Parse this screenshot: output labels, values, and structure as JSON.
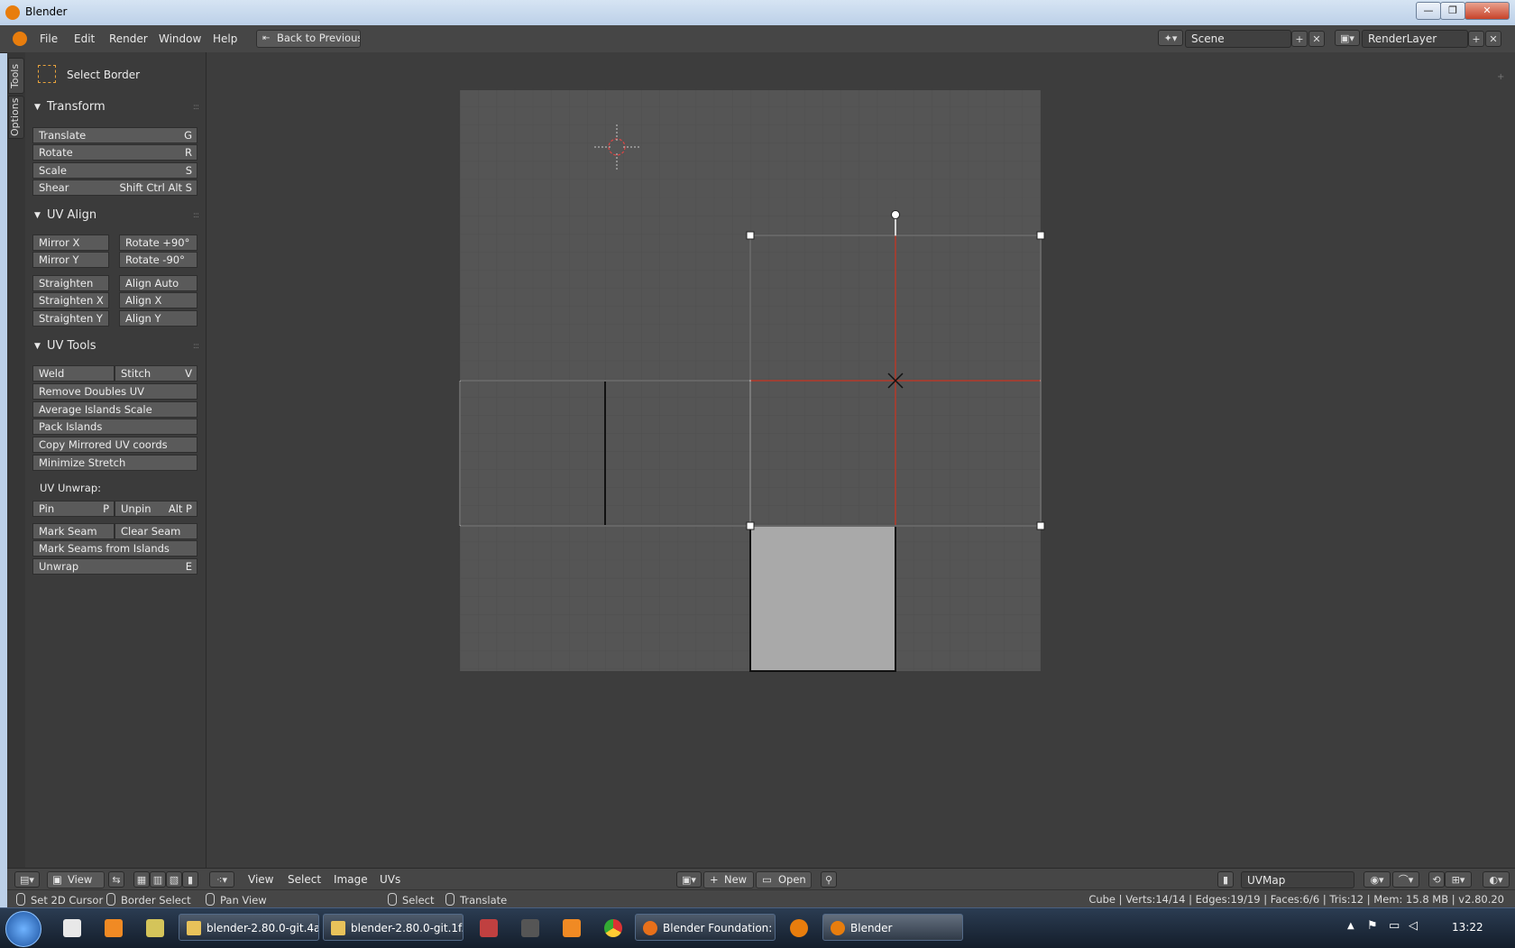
{
  "window": {
    "title": "Blender",
    "minimize": "—",
    "maximize": "❐",
    "close": "✕"
  },
  "menubar": {
    "items": [
      "File",
      "Edit",
      "Render",
      "Window",
      "Help"
    ],
    "back_button": "Back to Previous",
    "scene_field": "Scene",
    "renderlayer_field": "RenderLayer"
  },
  "tabs": {
    "tools": "Tools",
    "options": "Options"
  },
  "toolshelf": {
    "active_tool": "Select Border",
    "transform": {
      "title": "Transform",
      "items": [
        {
          "label": "Translate",
          "key": "G"
        },
        {
          "label": "Rotate",
          "key": "R"
        },
        {
          "label": "Scale",
          "key": "S"
        },
        {
          "label": "Shear",
          "key": "Shift Ctrl Alt S"
        }
      ]
    },
    "uv_align": {
      "title": "UV Align",
      "mirror_x": "Mirror X",
      "rotate_p90": "Rotate +90°",
      "mirror_y": "Mirror Y",
      "rotate_m90": "Rotate  -90°",
      "straighten": "Straighten",
      "align_auto": "Align Auto",
      "straighten_x": "Straighten X",
      "align_x": "Align X",
      "straighten_y": "Straighten Y",
      "align_y": "Align Y"
    },
    "uv_tools": {
      "title": "UV Tools",
      "weld": "Weld",
      "stitch": "Stitch",
      "stitch_key": "V",
      "remove_doubles": "Remove Doubles UV",
      "average_islands": "Average Islands Scale",
      "pack_islands": "Pack Islands",
      "copy_mirrored": "Copy Mirrored UV coords",
      "minimize_stretch": "Minimize Stretch",
      "unwrap_label": "UV Unwrap:",
      "pin": "Pin",
      "pin_key": "P",
      "unpin": "Unpin",
      "unpin_key": "Alt P",
      "mark_seam": "Mark Seam",
      "clear_seam": "Clear Seam",
      "mark_seams_islands": "Mark Seams from Islands",
      "unwrap": "Unwrap",
      "unwrap_key": "E"
    }
  },
  "editor_header": {
    "view_menu": "View",
    "menus": [
      "View",
      "Select",
      "Image",
      "UVs"
    ],
    "new_button": "New",
    "open_button": "Open",
    "uvmap_field": "UVMap"
  },
  "statusbar": {
    "set_cursor": "Set 2D Cursor",
    "border_select": "Border Select",
    "pan_view": "Pan View",
    "select": "Select",
    "translate": "Translate",
    "stats": "Cube | Verts:14/14 | Edges:19/19 | Faces:6/6 | Tris:12 | Mem: 15.8 MB | v2.80.20"
  },
  "taskbar": {
    "tasks": [
      "blender-2.80.0-git.4a...",
      "blender-2.80.0-git.1f...",
      "Blender Foundation: ...",
      "Blender"
    ],
    "clock": "13:22"
  },
  "colors": {
    "accent": "#e87d0d",
    "selected_edge": "#ffffff",
    "seam": "#c0392b"
  }
}
